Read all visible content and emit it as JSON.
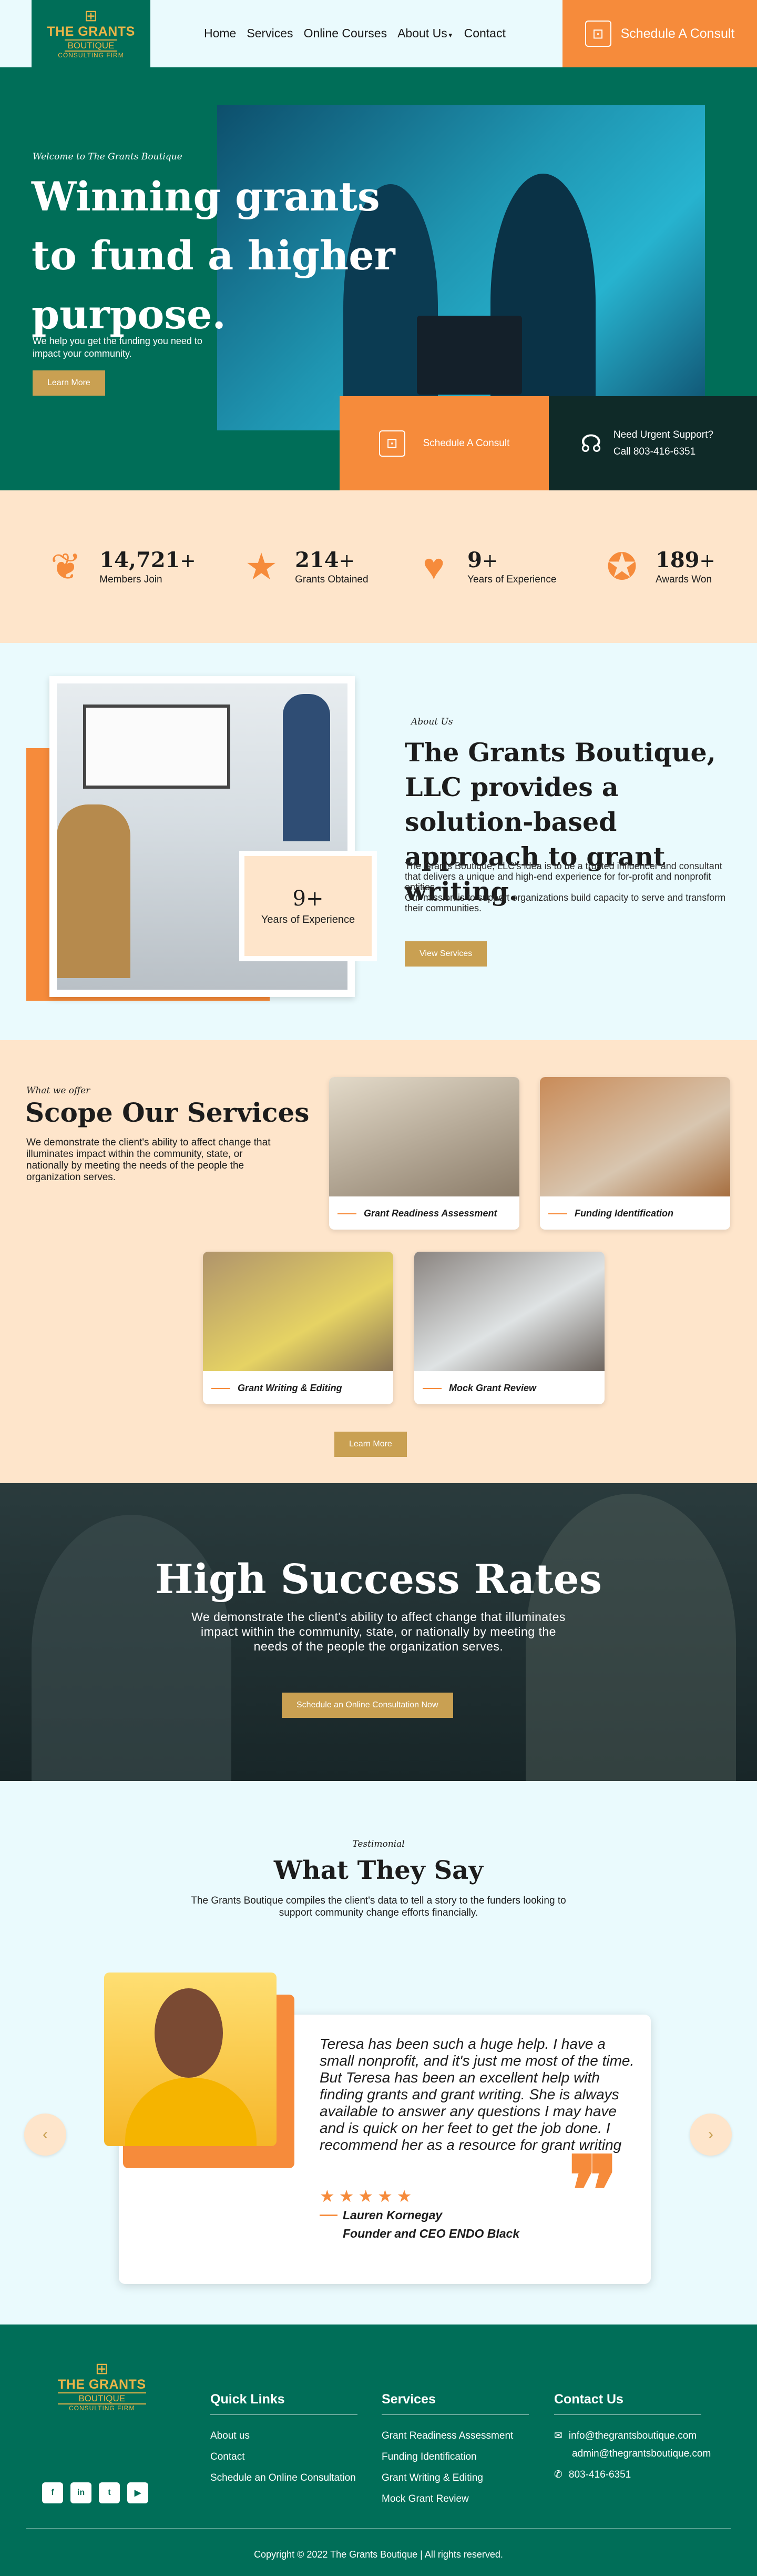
{
  "header": {
    "logo": {
      "title": "THE GRANTS",
      "sub": "BOUTIQUE",
      "foot": "CONSULTING FIRM"
    },
    "nav": [
      "Home",
      "Services",
      "Online Courses",
      "About Us",
      "Contact"
    ],
    "consult_label": "Schedule A Consult"
  },
  "hero": {
    "eyebrow": "Welcome to The Grants Boutique",
    "title": "Winning grants to fund a higher purpose.",
    "subtitle": "We help you get the funding you need to impact your community.",
    "button": "Learn More",
    "consult": "Schedule A Consult",
    "support_title": "Need Urgent Support?",
    "support_phone": "Call 803-416-6351"
  },
  "stats": [
    {
      "icon": "paw-icon",
      "num": "14,721",
      "label": "Members Join"
    },
    {
      "icon": "hand-stars-icon",
      "num": "214",
      "label": "Grants Obtained"
    },
    {
      "icon": "hand-heart-icon",
      "num": "9",
      "label": "Years of Experience"
    },
    {
      "icon": "award-icon",
      "num": "189",
      "label": "Awards Won"
    }
  ],
  "about": {
    "eyebrow": "About Us",
    "title": "The Grants Boutique, LLC provides a solution-based approach to grant writing.",
    "text": "The Grants Boutique, LLC's idea is to be a trusted influencer and consultant that delivers a unique and high-end experience for for-profit and nonprofit entities.\nOur mission is to support organizations build capacity to serve and transform their communities.",
    "button": "View Services",
    "xp_num": "9",
    "xp_label": "Years of Experience"
  },
  "services": {
    "eyebrow": "What we offer",
    "title": "Scope Our Services",
    "text": "We demonstrate the client's ability to affect change that illuminates impact within the community, state, or nationally by meeting the needs of the people the organization serves.",
    "cards": [
      "Grant Readiness Assessment",
      "Funding Identification",
      "Grant Writing & Editing",
      "Mock Grant Review"
    ],
    "button": "Learn More"
  },
  "success": {
    "title": "High Success Rates",
    "text": "We demonstrate the client's ability to affect change that illuminates impact within the community, state, or nationally by meeting the needs of the people the organization serves.",
    "button": "Schedule an Online Consultation Now"
  },
  "testimonial": {
    "eyebrow": "Testimonial",
    "title": "What They Say",
    "subtitle": "The Grants Boutique compiles the client's data to tell a story to the funders looking to support community change efforts financially.",
    "quote": "Teresa has been such a huge help. I have a small nonprofit, and it's just me most of the time. But Teresa has been an excellent help with finding grants and grant writing. She is always available to answer any questions I may have and is quick on her feet to get the job done. I recommend her as a resource for grant writing",
    "stars": "★★★★★",
    "name": "Lauren Kornegay",
    "role": "Founder and CEO ENDO Black"
  },
  "footer": {
    "quick_title": "Quick Links",
    "quick": [
      "About us",
      "Contact",
      "Schedule an Online Consultation"
    ],
    "services_title": "Services",
    "services": [
      "Grant Readiness Assessment",
      "Funding Identification",
      "Grant Writing & Editing",
      "Mock Grant Review"
    ],
    "contact_title": "Contact Us",
    "email1": "info@thegrantsboutique.com",
    "email2": "admin@thegrantsboutique.com",
    "phone": "803-416-6351",
    "copyright": "Copyright © 2022 The Grants Boutique | All rights reserved."
  }
}
